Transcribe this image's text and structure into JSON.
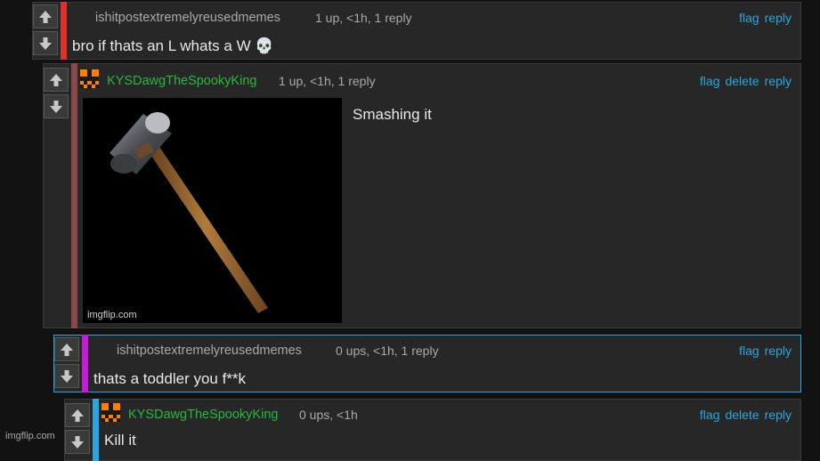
{
  "vote": {
    "up_label": "upvote",
    "down_label": "downvote"
  },
  "comments": [
    {
      "username": "ishitpostextremelyreusedmemes",
      "meta": "1 up, <1h, 1 reply",
      "text": "bro if thats an L whats a W 💀",
      "actions": [
        "flag",
        "reply"
      ],
      "bar_color": "#e0302c"
    },
    {
      "username": "KYSDawgTheSpookyKing",
      "meta": "1 up, <1h, 1 reply",
      "text": "Smashing it",
      "actions": [
        "flag",
        "delete",
        "reply"
      ],
      "bar_color": "#8a4a4a",
      "image": {
        "caption": "imgflip.com",
        "icon": "sledgehammer-image"
      }
    },
    {
      "username": "ishitpostextremelyreusedmemes",
      "meta": "0 ups, <1h, 1 reply",
      "text": "thats a toddler you f**k",
      "actions": [
        "flag",
        "reply"
      ],
      "bar_color": "#c21ed6"
    },
    {
      "username": "KYSDawgTheSpookyKing",
      "meta": "0 ups, <1h",
      "text": "Kill it",
      "actions": [
        "flag",
        "delete",
        "reply"
      ],
      "bar_color": "#2aa7dd"
    }
  ],
  "watermark": "imgflip.com",
  "colors": {
    "accent": "#2aa7dd",
    "username_green": "#27b83c",
    "avatar_orange": "#ff7f00"
  }
}
